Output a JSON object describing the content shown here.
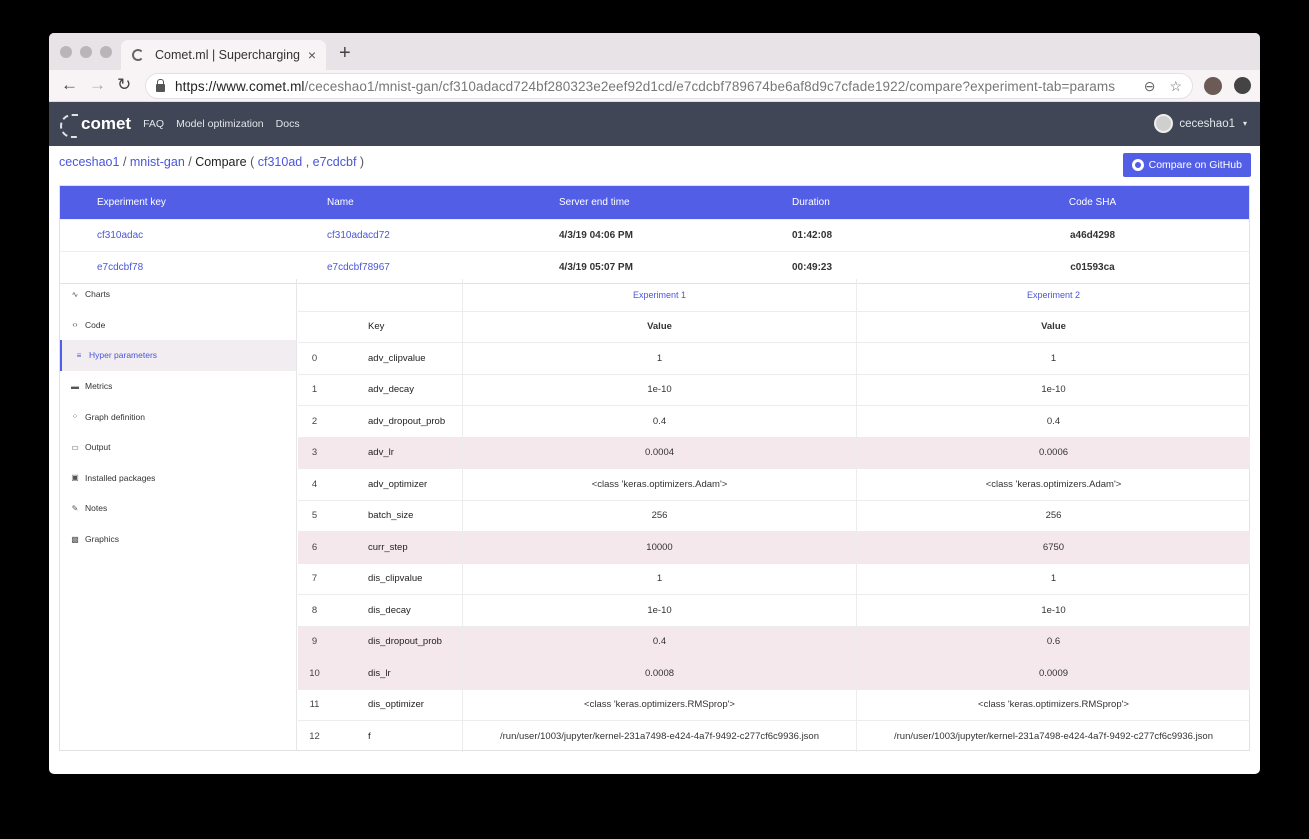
{
  "browser": {
    "tab_title": "Comet.ml | Supercharging Mac",
    "tab_close": "×",
    "new_tab": "+",
    "url_host": "https://www.comet.ml",
    "url_rest": "/ceceshao1/mnist-gan/cf310adacd724bf280323e2eef92d1cd/e7cdcbf789674be6af8d9c7cfade1922/compare?experiment-tab=params",
    "back": "←",
    "forward": "→",
    "reload": "↻",
    "zoom": "⊖",
    "star": "☆"
  },
  "appnav": {
    "logo": "comet",
    "links": [
      "FAQ",
      "Model optimization",
      "Docs"
    ],
    "username": "ceceshao1",
    "caret": "▾"
  },
  "breadcrumb": {
    "user": "ceceshao1",
    "sep": " / ",
    "project": "mnist-gan",
    "current": "Compare",
    "open": " ( ",
    "exp1": "cf310ad",
    "comma": " , ",
    "exp2": "e7cdcbf",
    "close": " )"
  },
  "github_button": "Compare on GitHub",
  "experiments": {
    "headers": [
      "Experiment key",
      "Name",
      "Server end time",
      "Duration",
      "Code SHA"
    ],
    "rows": [
      {
        "key": "cf310adac",
        "name": "cf310adacd72",
        "end": "4/3/19 04:06 PM",
        "duration": "01:42:08",
        "sha": "a46d4298"
      },
      {
        "key": "e7cdcbf78",
        "name": "e7cdcbf78967",
        "end": "4/3/19 05:07 PM",
        "duration": "00:49:23",
        "sha": "c01593ca"
      }
    ]
  },
  "sidebar": {
    "items": [
      {
        "label": "Charts",
        "icon": "∿"
      },
      {
        "label": "Code",
        "icon": "‹›"
      },
      {
        "label": "Hyper parameters",
        "icon": "≡"
      },
      {
        "label": "Metrics",
        "icon": "▬"
      },
      {
        "label": "Graph definition",
        "icon": "⁘"
      },
      {
        "label": "Output",
        "icon": "▭"
      },
      {
        "label": "Installed packages",
        "icon": "▣"
      },
      {
        "label": "Notes",
        "icon": "✎"
      },
      {
        "label": "Graphics",
        "icon": "▩"
      }
    ],
    "active_index": 2
  },
  "params": {
    "experiment_headers": [
      "Experiment 1",
      "Experiment 2"
    ],
    "key_header": "Key",
    "value_header": "Value",
    "rows": [
      {
        "idx": "0",
        "key": "adv_clipvalue",
        "v1": "1",
        "v2": "1",
        "diff": false
      },
      {
        "idx": "1",
        "key": "adv_decay",
        "v1": "1e-10",
        "v2": "1e-10",
        "diff": false
      },
      {
        "idx": "2",
        "key": "adv_dropout_prob",
        "v1": "0.4",
        "v2": "0.4",
        "diff": false
      },
      {
        "idx": "3",
        "key": "adv_lr",
        "v1": "0.0004",
        "v2": "0.0006",
        "diff": true
      },
      {
        "idx": "4",
        "key": "adv_optimizer",
        "v1": "<class 'keras.optimizers.Adam'>",
        "v2": "<class 'keras.optimizers.Adam'>",
        "diff": false
      },
      {
        "idx": "5",
        "key": "batch_size",
        "v1": "256",
        "v2": "256",
        "diff": false
      },
      {
        "idx": "6",
        "key": "curr_step",
        "v1": "10000",
        "v2": "6750",
        "diff": true
      },
      {
        "idx": "7",
        "key": "dis_clipvalue",
        "v1": "1",
        "v2": "1",
        "diff": false
      },
      {
        "idx": "8",
        "key": "dis_decay",
        "v1": "1e-10",
        "v2": "1e-10",
        "diff": false
      },
      {
        "idx": "9",
        "key": "dis_dropout_prob",
        "v1": "0.4",
        "v2": "0.6",
        "diff": true
      },
      {
        "idx": "10",
        "key": "dis_lr",
        "v1": "0.0008",
        "v2": "0.0009",
        "diff": true
      },
      {
        "idx": "11",
        "key": "dis_optimizer",
        "v1": "<class 'keras.optimizers.RMSprop'>",
        "v2": "<class 'keras.optimizers.RMSprop'>",
        "diff": false
      },
      {
        "idx": "12",
        "key": "f",
        "v1": "/run/user/1003/jupyter/kernel-231a7498-e424-4a7f-9492-c277cf6c9936.json",
        "v2": "/run/user/1003/jupyter/kernel-231a7498-e424-4a7f-9492-c277cf6c9936.json",
        "diff": false
      }
    ]
  },
  "colors": {
    "accent": "#535ee6",
    "nav_bg": "#404655",
    "diff_row": "#f4e8ec"
  }
}
